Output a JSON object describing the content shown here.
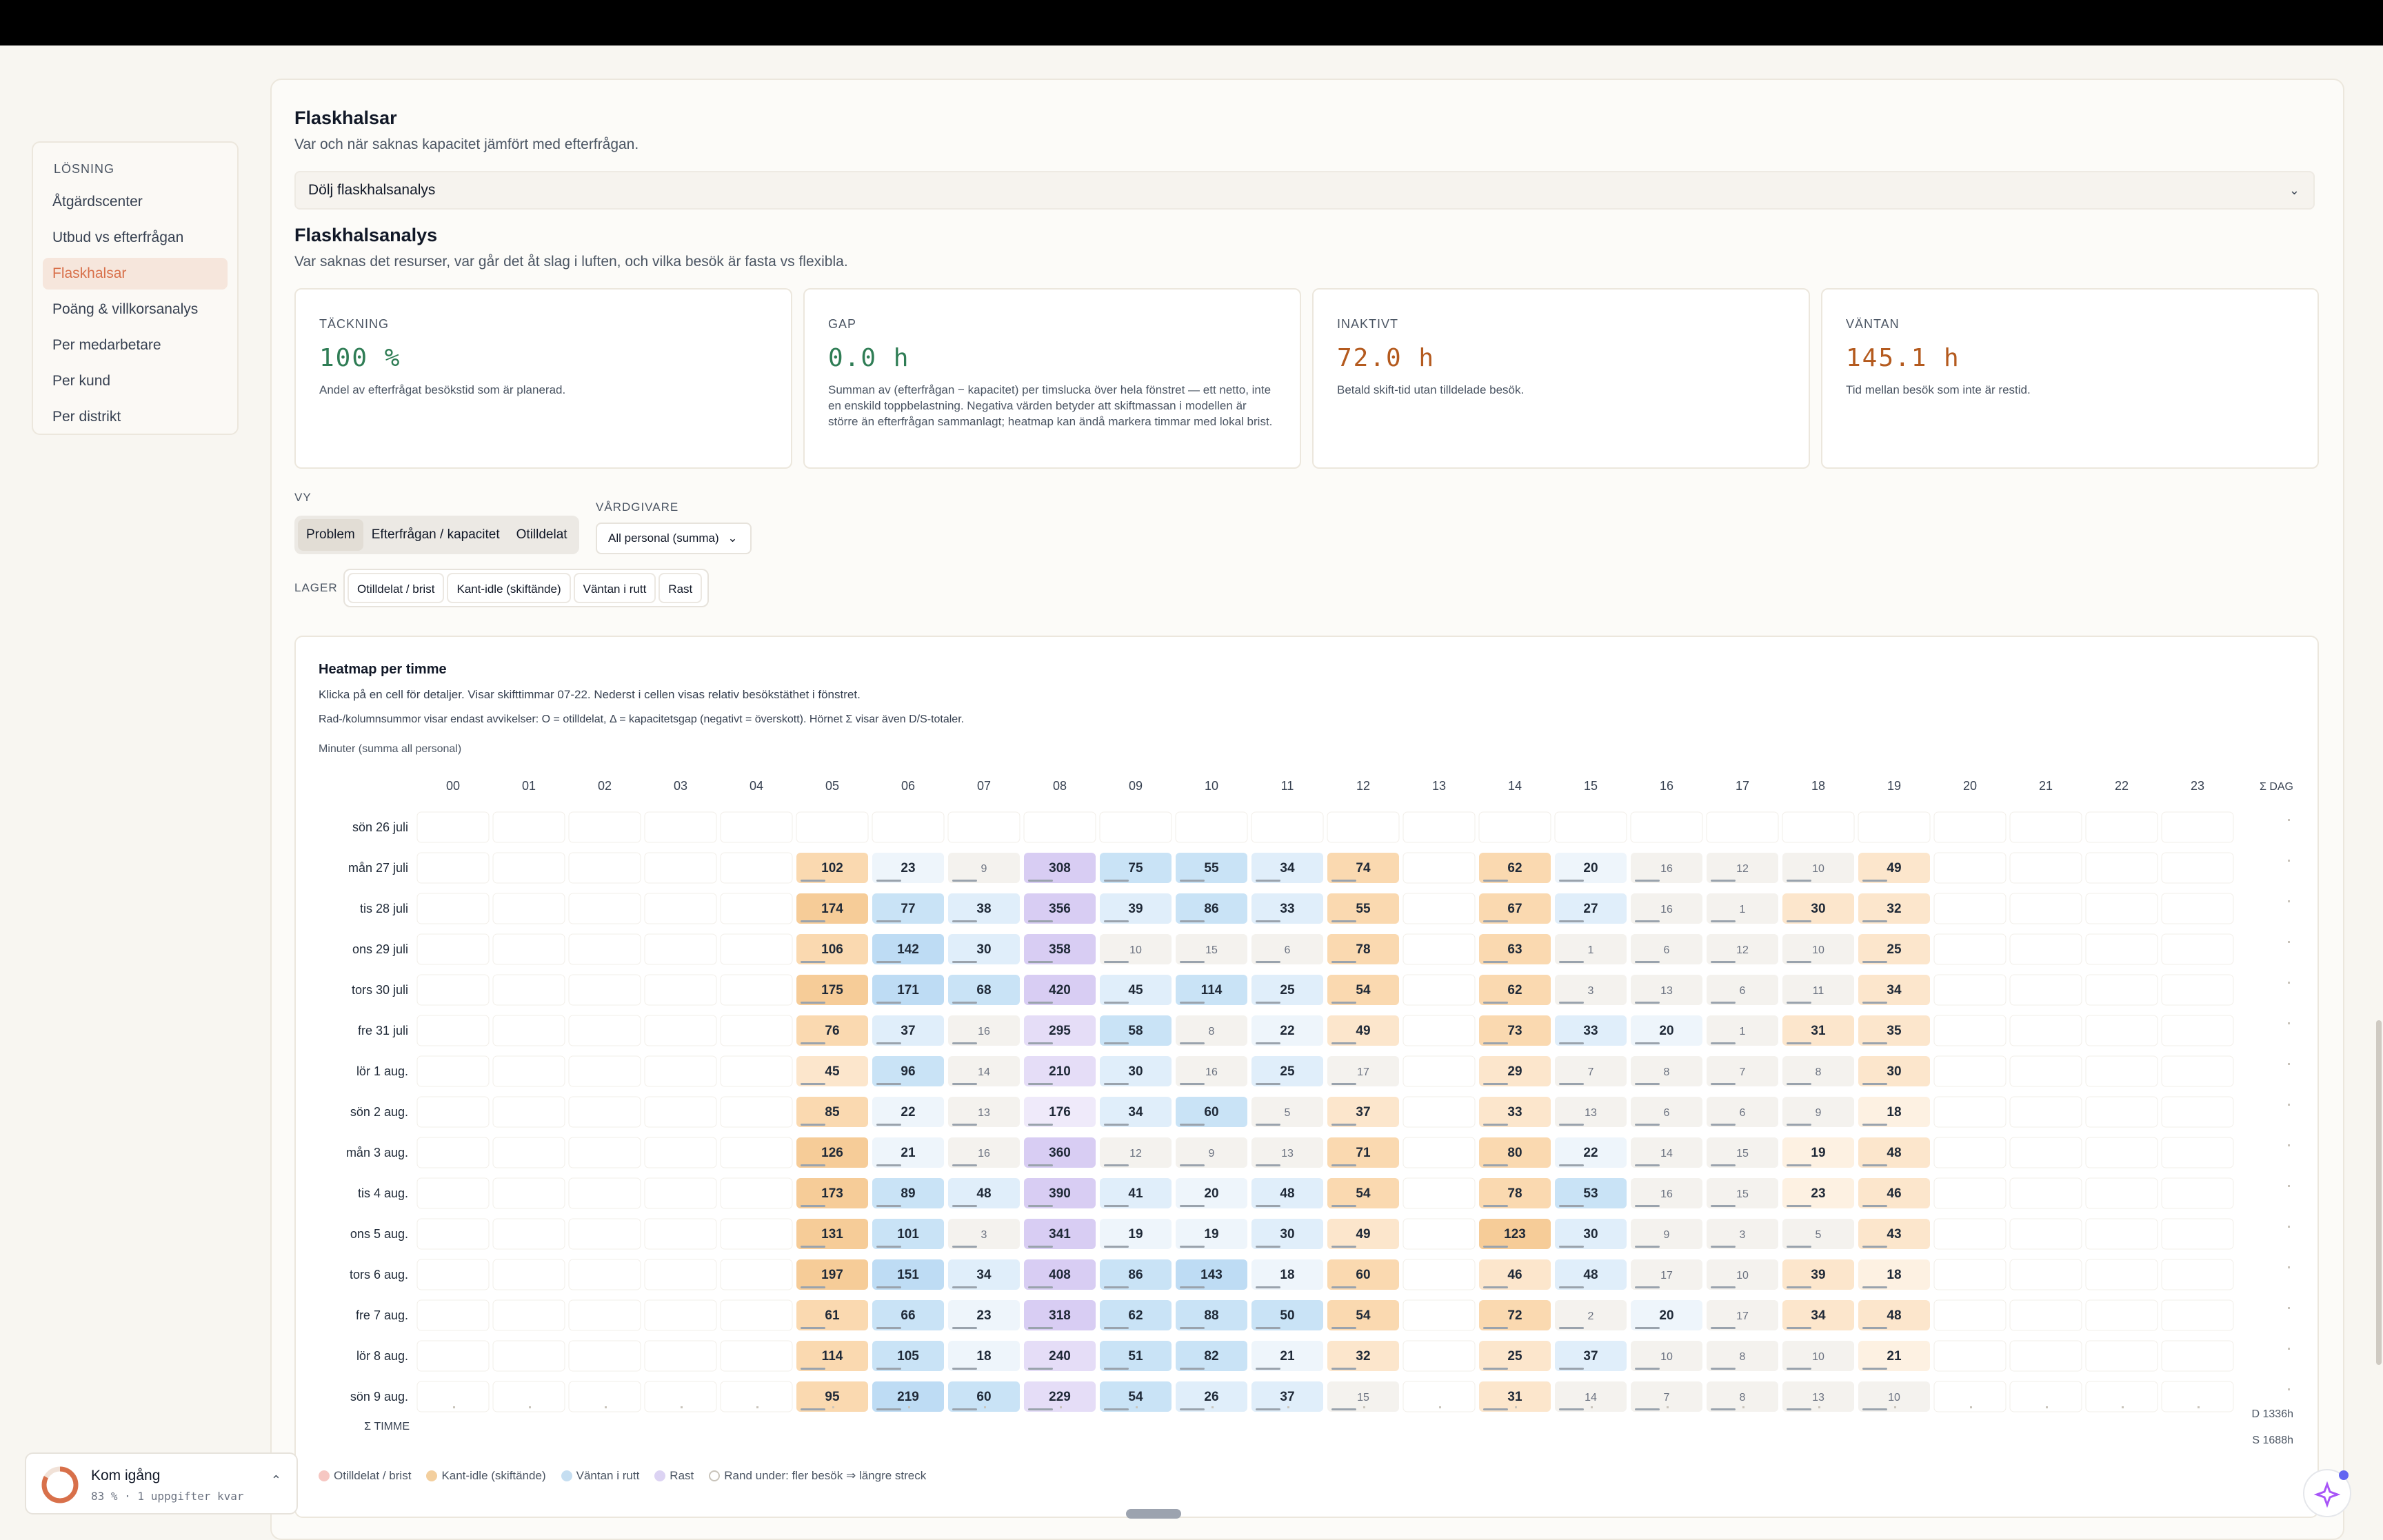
{
  "sidebar": {
    "section": "LÖSNING",
    "items": [
      "Åtgärdscenter",
      "Utbud vs efterfrågan",
      "Flaskhalsar",
      "Poäng & villkorsanalys",
      "Per medarbetare",
      "Per kund",
      "Per distrikt"
    ],
    "active_index": 2
  },
  "page": {
    "title": "Flaskhalsar",
    "subtitle": "Var och när saknas kapacitet jämfört med efterfrågan.",
    "collapse_label": "Dölj flaskhalsanalys",
    "analysis_title": "Flaskhalsanalys",
    "analysis_subtitle": "Var saknas det resurser, var går det åt slag i luften, och vilka besök är fasta vs flexibla."
  },
  "kpis": [
    {
      "label": "TÄCKNING",
      "value": "100 %",
      "desc": "Andel av efterfrågat besökstid som är planerad.",
      "color": "#2f7d55"
    },
    {
      "label": "GAP",
      "value": "0.0 h",
      "desc": "Summan av (efterfrågan − kapacitet) per timslucka över hela fönstret — ett netto, inte en enskild toppbelastning. Negativa värden betyder att skiftmassan i modellen är större än efterfrågan sammanlagt; heatmap kan ändå markera timmar med lokal brist.",
      "color": "#2f7d55"
    },
    {
      "label": "INAKTIVT",
      "value": "72.0 h",
      "desc": "Betald skift-tid utan tilldelade besök.",
      "color": "#b45a1e"
    },
    {
      "label": "VÄNTAN",
      "value": "145.1 h",
      "desc": "Tid mellan besök som inte är restid.",
      "color": "#b45a1e"
    }
  ],
  "controls": {
    "view_label": "VY",
    "view_options": [
      "Problem",
      "Efterfrågan / kapacitet",
      "Otilldelat"
    ],
    "view_selected": "Problem",
    "provider_label": "VÅRDGIVARE",
    "provider_value": "All personal (summa)",
    "layers_label": "LAGER",
    "layers": [
      "Otilldelat / brist",
      "Kant-idle (skiftände)",
      "Väntan i rutt",
      "Rast"
    ]
  },
  "heatmap": {
    "title": "Heatmap per timme",
    "line1": "Klicka på en cell för detaljer. Visar skifttimmar 07-22. Nederst i cellen visas relativ besökstäthet i fönstret.",
    "line2": "Rad-/kolumnsummor visar endast avvikelser: O = otilldelat, Δ = kapacitetsgap (negativt = överskott). Hörnet Σ visar även D/S-totaler.",
    "unit_note": "Minuter (summa all personal)",
    "hours": [
      "00",
      "01",
      "02",
      "03",
      "04",
      "05",
      "06",
      "07",
      "08",
      "09",
      "10",
      "11",
      "12",
      "13",
      "14",
      "15",
      "16",
      "17",
      "18",
      "19",
      "20",
      "21",
      "22",
      "23"
    ],
    "sum_day_label": "Σ DAG",
    "sum_hour_label": "Σ TIMME",
    "corner_d": "D 1336h",
    "corner_s": "S 1688h",
    "rows": [
      {
        "day": "sön 26 juli",
        "vals": [
          null,
          null,
          null,
          null,
          null,
          null,
          null,
          null,
          null,
          null,
          null,
          null,
          null,
          null,
          null,
          null,
          null,
          null,
          null,
          null,
          null,
          null,
          null,
          null
        ]
      },
      {
        "day": "mån 27 juli",
        "vals": [
          null,
          null,
          null,
          null,
          null,
          102,
          23,
          9,
          308,
          75,
          55,
          34,
          74,
          null,
          62,
          20,
          16,
          12,
          10,
          49,
          null,
          null,
          null,
          null
        ]
      },
      {
        "day": "tis 28 juli",
        "vals": [
          null,
          null,
          null,
          null,
          null,
          174,
          77,
          38,
          356,
          39,
          86,
          33,
          55,
          null,
          67,
          27,
          16,
          1,
          30,
          32,
          null,
          null,
          null,
          null
        ]
      },
      {
        "day": "ons 29 juli",
        "vals": [
          null,
          null,
          null,
          null,
          null,
          106,
          142,
          30,
          358,
          10,
          15,
          6,
          78,
          null,
          63,
          1,
          6,
          12,
          10,
          25,
          null,
          null,
          null,
          null
        ]
      },
      {
        "day": "tors 30 juli",
        "vals": [
          null,
          null,
          null,
          null,
          null,
          175,
          171,
          68,
          420,
          45,
          114,
          25,
          54,
          null,
          62,
          3,
          13,
          6,
          11,
          34,
          null,
          null,
          null,
          null
        ]
      },
      {
        "day": "fre 31 juli",
        "vals": [
          null,
          null,
          null,
          null,
          null,
          76,
          37,
          16,
          295,
          58,
          8,
          22,
          49,
          null,
          73,
          33,
          20,
          1,
          31,
          35,
          null,
          null,
          null,
          null
        ]
      },
      {
        "day": "lör 1 aug.",
        "vals": [
          null,
          null,
          null,
          null,
          null,
          45,
          96,
          14,
          210,
          30,
          16,
          25,
          17,
          null,
          29,
          7,
          8,
          7,
          8,
          30,
          null,
          null,
          null,
          null
        ]
      },
      {
        "day": "sön 2 aug.",
        "vals": [
          null,
          null,
          null,
          null,
          null,
          85,
          22,
          13,
          176,
          34,
          60,
          5,
          37,
          null,
          33,
          13,
          6,
          6,
          9,
          18,
          null,
          null,
          null,
          null
        ]
      },
      {
        "day": "mån 3 aug.",
        "vals": [
          null,
          null,
          null,
          null,
          null,
          126,
          21,
          16,
          360,
          12,
          9,
          13,
          71,
          null,
          80,
          22,
          14,
          15,
          19,
          48,
          null,
          null,
          null,
          null
        ]
      },
      {
        "day": "tis 4 aug.",
        "vals": [
          null,
          null,
          null,
          null,
          null,
          173,
          89,
          48,
          390,
          41,
          20,
          48,
          54,
          null,
          78,
          53,
          16,
          15,
          23,
          46,
          null,
          null,
          null,
          null
        ]
      },
      {
        "day": "ons 5 aug.",
        "vals": [
          null,
          null,
          null,
          null,
          null,
          131,
          101,
          3,
          341,
          19,
          19,
          30,
          49,
          null,
          123,
          30,
          9,
          3,
          5,
          43,
          null,
          null,
          null,
          null
        ]
      },
      {
        "day": "tors 6 aug.",
        "vals": [
          null,
          null,
          null,
          null,
          null,
          197,
          151,
          34,
          408,
          86,
          143,
          18,
          60,
          null,
          46,
          48,
          17,
          10,
          39,
          18,
          null,
          null,
          null,
          null
        ]
      },
      {
        "day": "fre 7 aug.",
        "vals": [
          null,
          null,
          null,
          null,
          null,
          61,
          66,
          23,
          318,
          62,
          88,
          50,
          54,
          null,
          72,
          2,
          20,
          17,
          34,
          48,
          null,
          null,
          null,
          null
        ]
      },
      {
        "day": "lör 8 aug.",
        "vals": [
          null,
          null,
          null,
          null,
          null,
          114,
          105,
          18,
          240,
          51,
          82,
          21,
          32,
          null,
          25,
          37,
          10,
          8,
          10,
          21,
          null,
          null,
          null,
          null
        ]
      },
      {
        "day": "sön 9 aug.",
        "vals": [
          null,
          null,
          null,
          null,
          null,
          95,
          219,
          60,
          229,
          54,
          26,
          37,
          15,
          null,
          31,
          14,
          7,
          8,
          13,
          10,
          null,
          null,
          null,
          null
        ]
      }
    ]
  },
  "legend": [
    "Otilldelat / brist",
    "Kant-idle (skiftände)",
    "Väntan i rutt",
    "Rast",
    "Rand under: fler besök ⇒ längre streck"
  ],
  "legend_colors": [
    "#f6c7c2",
    "#f3cf9e",
    "#c5def1",
    "#dcd3f3",
    "#ffffff"
  ],
  "toast": {
    "title": "Kom igång",
    "sub": "83 % · 1 uppgifter kvar",
    "progress": 0.83
  }
}
